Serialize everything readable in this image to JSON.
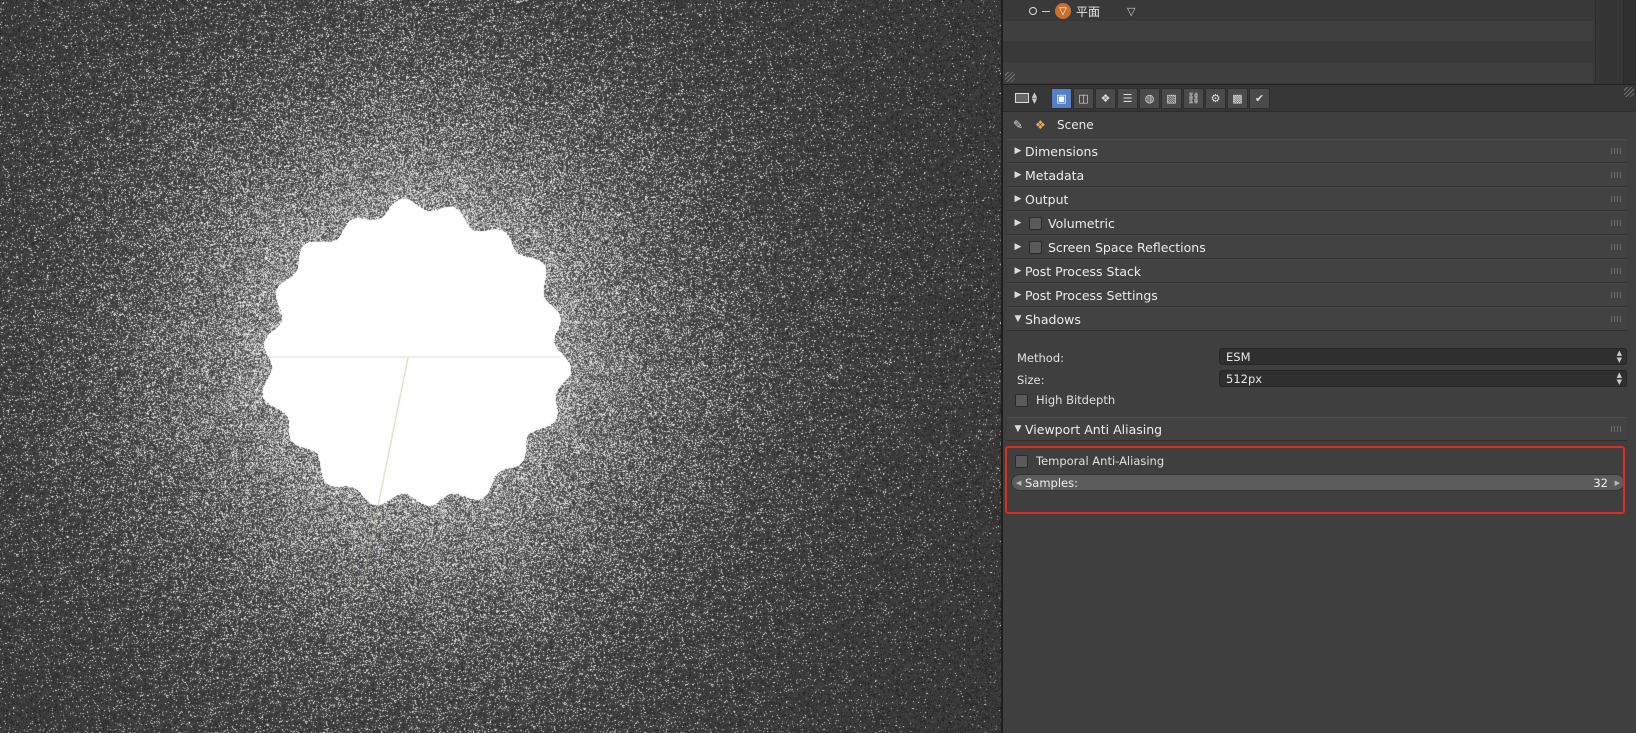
{
  "outliner": {
    "object_name": "平面",
    "mesh_icon": "mesh-cone-icon",
    "data_icon": "triangle-mesh-icon"
  },
  "properties": {
    "editor_type_icon": "properties-editor-icon",
    "context_tabs": [
      {
        "name": "render-tab",
        "icon": "camera-icon",
        "glyph": "▣",
        "active": true
      },
      {
        "name": "render-layers-tab",
        "icon": "layers-icon",
        "glyph": "◫",
        "active": false
      },
      {
        "name": "scene-tab",
        "icon": "scene-icon",
        "glyph": "❖",
        "active": false
      },
      {
        "name": "view-layer-tab",
        "icon": "list-icon",
        "glyph": "☰",
        "active": false
      },
      {
        "name": "world-tab",
        "icon": "world-icon",
        "glyph": "◍",
        "active": false
      },
      {
        "name": "object-tab",
        "icon": "cube-icon",
        "glyph": "▧",
        "active": false
      },
      {
        "name": "constraints-tab",
        "icon": "link-icon",
        "glyph": "⛓",
        "active": false
      },
      {
        "name": "modifiers-tab",
        "icon": "wrench-icon",
        "glyph": "⚙",
        "active": false
      },
      {
        "name": "texture-tab",
        "icon": "checker-icon",
        "glyph": "▩",
        "active": false
      },
      {
        "name": "tools-tab",
        "icon": "brush-icon",
        "glyph": "✔",
        "active": false
      }
    ],
    "context": {
      "pin_icon": "pin-icon",
      "scene_icon": "scene-icon",
      "label": "Scene"
    },
    "panels": {
      "dimensions": "Dimensions",
      "metadata": "Metadata",
      "output": "Output",
      "volumetric": "Volumetric",
      "ssr": "Screen Space Reflections",
      "post_stack": "Post Process Stack",
      "post_settings": "Post Process Settings",
      "shadows": "Shadows",
      "viewport_aa": "Viewport Anti Aliasing"
    },
    "shadows": {
      "method_label": "Method:",
      "method_value": "ESM",
      "size_label": "Size:",
      "size_value": "512px",
      "high_bitdepth": "High Bitdepth"
    },
    "viewport_aa": {
      "temporal_label": "Temporal Anti-Aliasing",
      "samples_label": "Samples:",
      "samples_value": "32"
    }
  },
  "colors": {
    "highlight": "#e22a1f",
    "active_tab": "#5680c2",
    "mesh_icon": "#c9702e"
  }
}
